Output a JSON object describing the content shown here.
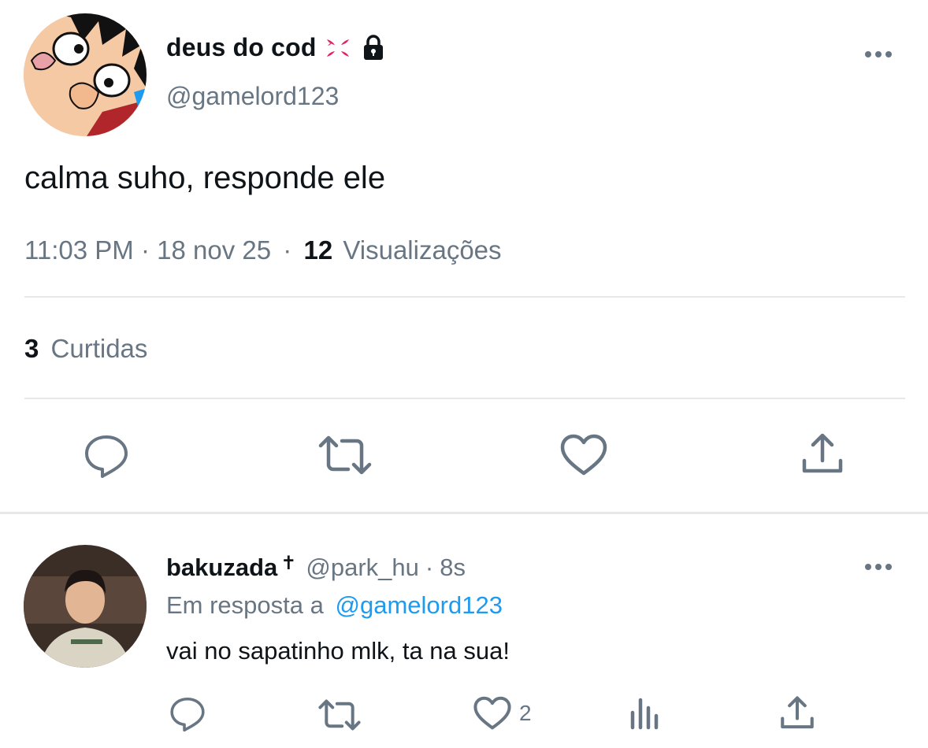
{
  "main_tweet": {
    "display_name": "deus do cod",
    "handle": "@gamelord123",
    "text": "calma suho, responde ele",
    "time": "11:03 PM",
    "date": "18 nov 25",
    "separator": "·",
    "views_count": "12",
    "views_label": "Visualizações",
    "likes_count": "3",
    "likes_label": "Curtidas"
  },
  "reply": {
    "display_name": "bakuzada",
    "name_symbol": "✝",
    "handle": "@park_hu",
    "separator": "·",
    "time": "8s",
    "in_reply_prefix": "Em resposta a",
    "in_reply_handle": "@gamelord123",
    "text": "vai no sapatinho mlk, ta na sua!",
    "like_count": "2"
  },
  "icons": {
    "name_emoji": "anger-symbol-icon",
    "protected": "lock-icon",
    "more": "more-icon",
    "reply": "reply-icon",
    "retweet": "retweet-icon",
    "like": "heart-icon",
    "share": "share-icon",
    "analytics": "analytics-icon"
  },
  "colors": {
    "text": "#0f1419",
    "secondary": "#687684",
    "link": "#1d9bf0",
    "anger": "#e0245e",
    "divider": "#e6e8ea"
  }
}
